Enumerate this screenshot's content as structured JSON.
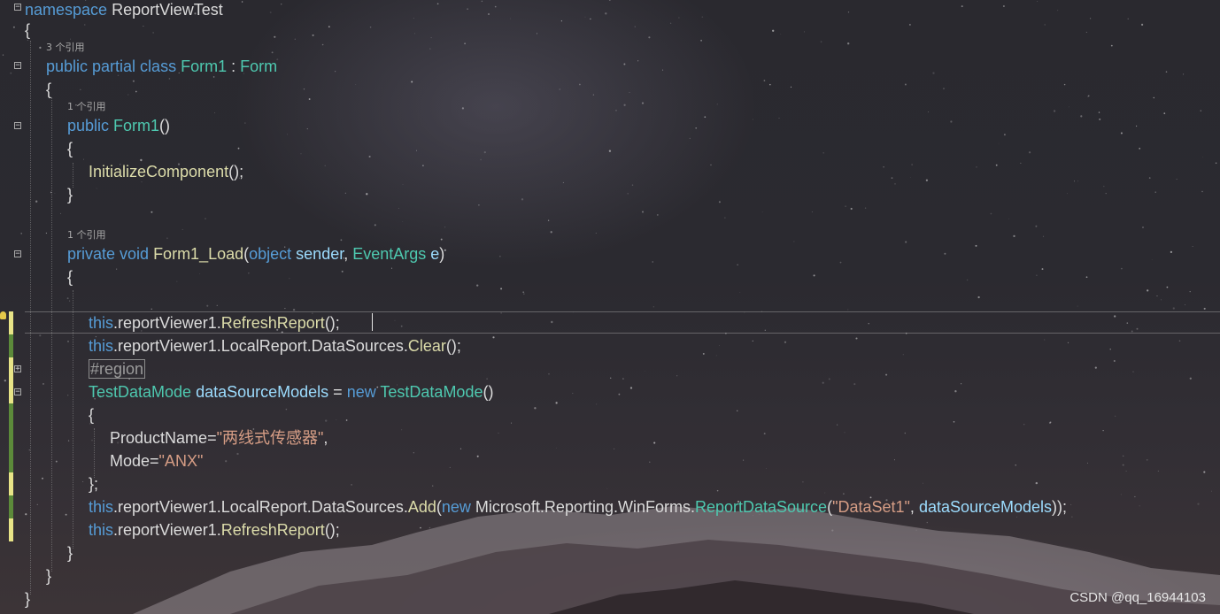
{
  "editor": {
    "lines": {
      "namespace": {
        "kw": "namespace",
        "name": " ReportViewTest"
      },
      "ns_open": "{",
      "class_refs": "3 个引用",
      "class_decl": {
        "kw": "public partial class ",
        "name": "Form1",
        "sep": " : ",
        "base": "Form"
      },
      "class_open": "{",
      "ctor_refs": "1 个引用",
      "ctor_decl": {
        "kw": "public ",
        "name": "Form1",
        "rest": "()"
      },
      "ctor_open": "{",
      "ctor_body": {
        "name": "InitializeComponent",
        "rest": "();"
      },
      "ctor_close": "}",
      "load_refs": "1 个引用",
      "load_decl": {
        "kw1": "private void ",
        "name": "Form1_Load",
        "p1": "(",
        "kw2": "object",
        "arg1": " sender",
        "comma": ", ",
        "type2": "EventArgs",
        "arg2": " e",
        "p2": ")"
      },
      "load_open": "{",
      "refresh1": {
        "kw": "this",
        "mid": ".reportViewer1.",
        "fn": "RefreshReport",
        "end": "();"
      },
      "clear": {
        "kw": "this",
        "mid": ".reportViewer1.LocalReport.DataSources.",
        "fn": "Clear",
        "end": "();"
      },
      "region": "#region",
      "decl": {
        "type": "TestDataMode",
        "sp": " ",
        "var": "dataSourceModels",
        "eq": " = ",
        "kw": "new",
        "sp2": " ",
        "type2": "TestDataMode",
        "end": "()"
      },
      "init_open": "{",
      "product": {
        "prop": "ProductName",
        "eq": "=",
        "val": "\"两线式传感器\"",
        "comma": ","
      },
      "mode": {
        "prop": "Mode",
        "eq": "=",
        "val": "\"ANX\""
      },
      "init_close": "};",
      "add": {
        "kw": "this",
        "mid": ".reportViewer1.LocalReport.DataSources.",
        "fn": "Add",
        "p1": "(",
        "kw2": "new",
        "ns": " Microsoft.Reporting.WinForms.",
        "type": "ReportDataSource",
        "p2": "(",
        "str": "\"DataSet1\"",
        "comma": ", ",
        "arg": "dataSourceModels",
        "end": "));"
      },
      "refresh2": {
        "kw": "this",
        "mid": ".reportViewer1.",
        "fn": "RefreshReport",
        "end": "();"
      },
      "load_close": "}",
      "class_close": "}",
      "ns_close": "}"
    },
    "fold_glyphs": {
      "collapse": "−",
      "expand": "+"
    }
  },
  "watermark": "CSDN @qq_16944103",
  "colors": {
    "keyword": "#569cd6",
    "type": "#4ec9b0",
    "method": "#dcdcaa",
    "parameter": "#9cdcfe",
    "string": "#d69d85",
    "plain": "#dcdcdc",
    "change_saved": "#5c8a3a",
    "change_unsaved": "#e8e487"
  }
}
